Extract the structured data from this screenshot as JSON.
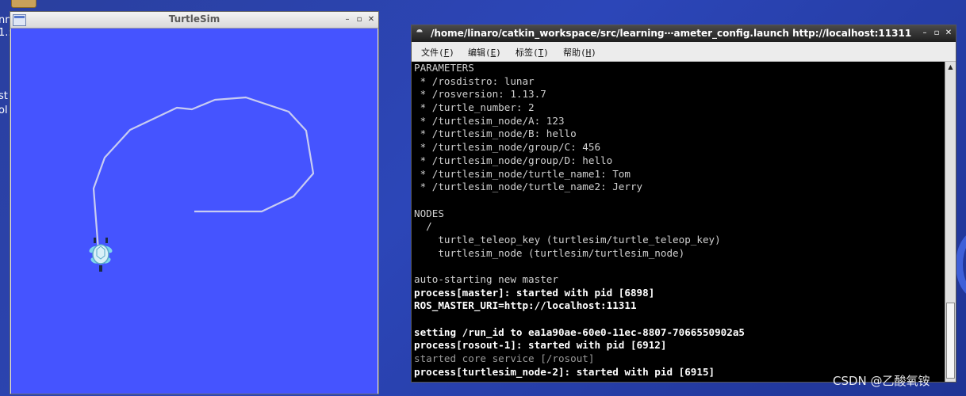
{
  "desktop": {
    "label_lines": [
      "nn",
      "1.:",
      "",
      "",
      "st",
      "ol"
    ]
  },
  "turtlesim": {
    "title": "TurtleSim",
    "minimize": "–",
    "maximize": "▫",
    "close": "✕",
    "background_color": "#4554ff",
    "trail_color": "#c8ccf2"
  },
  "terminal": {
    "title": "/home/linaro/catkin_workspace/src/learning⋯ameter_config.launch http://localhost:11311",
    "minimize": "–",
    "maximize": "▫",
    "close": "✕",
    "menu": [
      {
        "text": "文件(",
        "key": "F",
        "tail": ")"
      },
      {
        "text": "编辑(",
        "key": "E",
        "tail": ")"
      },
      {
        "text": "标签(",
        "key": "T",
        "tail": ")"
      },
      {
        "text": "帮助(",
        "key": "H",
        "tail": ")"
      }
    ],
    "lines": [
      {
        "text": "PARAMETERS",
        "style": "normal"
      },
      {
        "text": " * /rosdistro: lunar",
        "style": "normal"
      },
      {
        "text": " * /rosversion: 1.13.7",
        "style": "normal"
      },
      {
        "text": " * /turtle_number: 2",
        "style": "normal"
      },
      {
        "text": " * /turtlesim_node/A: 123",
        "style": "normal"
      },
      {
        "text": " * /turtlesim_node/B: hello",
        "style": "normal"
      },
      {
        "text": " * /turtlesim_node/group/C: 456",
        "style": "normal"
      },
      {
        "text": " * /turtlesim_node/group/D: hello",
        "style": "normal"
      },
      {
        "text": " * /turtlesim_node/turtle_name1: Tom",
        "style": "normal"
      },
      {
        "text": " * /turtlesim_node/turtle_name2: Jerry",
        "style": "normal"
      },
      {
        "text": "",
        "style": "normal"
      },
      {
        "text": "NODES",
        "style": "normal"
      },
      {
        "text": "  /",
        "style": "normal"
      },
      {
        "text": "    turtle_teleop_key (turtlesim/turtle_teleop_key)",
        "style": "normal"
      },
      {
        "text": "    turtlesim_node (turtlesim/turtlesim_node)",
        "style": "normal"
      },
      {
        "text": "",
        "style": "normal"
      },
      {
        "text": "auto-starting new master",
        "style": "normal"
      },
      {
        "text": "process[master]: started with pid [6898]",
        "style": "bold"
      },
      {
        "text": "ROS_MASTER_URI=http://localhost:11311",
        "style": "bold"
      },
      {
        "text": "",
        "style": "normal"
      },
      {
        "text": "setting /run_id to ea1a90ae-60e0-11ec-8807-7066550902a5",
        "style": "bold"
      },
      {
        "text": "process[rosout-1]: started with pid [6912]",
        "style": "bold"
      },
      {
        "text": "started core service [/rosout]",
        "style": "dim"
      },
      {
        "text": "process[turtlesim_node-2]: started with pid [6915]",
        "style": "bold"
      }
    ]
  },
  "watermark": "CSDN @乙酸氧铵"
}
